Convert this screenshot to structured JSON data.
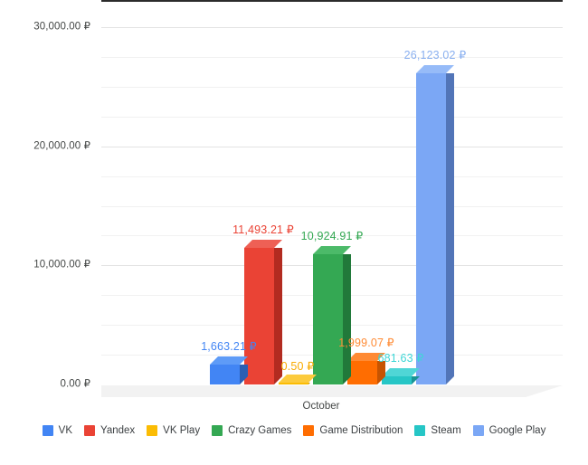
{
  "chart_data": {
    "type": "bar",
    "title": "",
    "subtitle": "",
    "xlabel": "",
    "ylabel": "",
    "categories": [
      "October"
    ],
    "x": [
      "October"
    ],
    "ylim": [
      0,
      30000
    ],
    "grid": true,
    "legend_position": "bottom",
    "style": "3d-column",
    "currency_symbol": "₽",
    "y_ticks": [
      {
        "value": 0,
        "label": "0.00 ₽"
      },
      {
        "value": 10000,
        "label": "10,000.00 ₽"
      },
      {
        "value": 20000,
        "label": "20,000.00 ₽"
      },
      {
        "value": 30000,
        "label": "30,000.00 ₽"
      }
    ],
    "minor_tick_step": 2500,
    "series": [
      {
        "name": "VK",
        "values": [
          1663.21
        ],
        "label": "1,663.21 ₽",
        "color": "#4285F4",
        "side_color": "#2B5FB3",
        "top_color": "#5E9BF7",
        "label_color": "#4285F4"
      },
      {
        "name": "Yandex",
        "values": [
          11493.21
        ],
        "label": "11,493.21 ₽",
        "color": "#EA4335",
        "side_color": "#B22B20",
        "top_color": "#EE6055",
        "label_color": "#EA4335"
      },
      {
        "name": "VK Play",
        "values": [
          0.5
        ],
        "label": "0.50 ₽",
        "color": "#FBBC04",
        "side_color": "#C79203",
        "top_color": "#FCCB3D",
        "label_color": "#F9AB00"
      },
      {
        "name": "Crazy Games",
        "values": [
          10924.91
        ],
        "label": "10,924.91 ₽",
        "color": "#34A853",
        "side_color": "#21793A",
        "top_color": "#4CBA69",
        "label_color": "#34A853"
      },
      {
        "name": "Game Distribution",
        "values": [
          1999.07
        ],
        "label": "1,999.07 ₽",
        "color": "#FF6D01",
        "side_color": "#C75401",
        "top_color": "#FF8A33",
        "label_color": "#FF8A33"
      },
      {
        "name": "Steam",
        "values": [
          681.63
        ],
        "label": "681.63 ₽",
        "color": "#26C6C6",
        "side_color": "#199494",
        "top_color": "#4FD6D6",
        "label_color": "#3DD6D6"
      },
      {
        "name": "Google Play",
        "values": [
          26123.02
        ],
        "label": "26,123.02 ₽",
        "color": "#7BA7F5",
        "side_color": "#5275B8",
        "top_color": "#96BBF8",
        "label_color": "#8AB0F0"
      }
    ]
  },
  "legend": {
    "items": [
      {
        "name": "VK",
        "color": "#4285F4"
      },
      {
        "name": "Yandex",
        "color": "#EA4335"
      },
      {
        "name": "VK Play",
        "color": "#FBBC04"
      },
      {
        "name": "Crazy Games",
        "color": "#34A853"
      },
      {
        "name": "Game Distribution",
        "color": "#FF6D01"
      },
      {
        "name": "Steam",
        "color": "#26C6C6"
      },
      {
        "name": "Google Play",
        "color": "#7BA7F5"
      }
    ]
  },
  "axis": {
    "category_label": "October"
  }
}
